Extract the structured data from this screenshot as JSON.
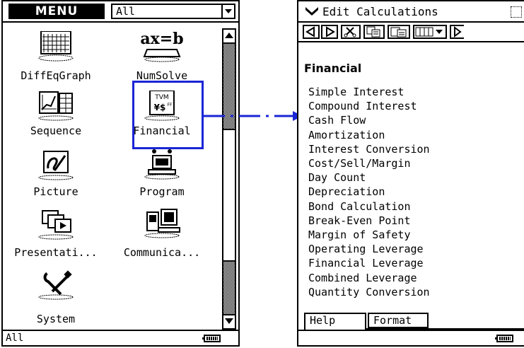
{
  "menu": {
    "title": "MENU",
    "category_value": "All",
    "status_category": "All",
    "apps": [
      {
        "label": "DiffEqGraph",
        "icon": "diffeqgraph-icon"
      },
      {
        "label": "NumSolve",
        "icon": "numsolve-icon",
        "icon_text": "ax=b"
      },
      {
        "label": "Sequence",
        "icon": "sequence-icon"
      },
      {
        "label": "Financial",
        "icon": "financial-icon",
        "icon_text_1": "TVM",
        "icon_text_2": "¥$",
        "icon_text_3": "FF"
      },
      {
        "label": "Picture",
        "icon": "picture-icon"
      },
      {
        "label": "Program",
        "icon": "program-icon"
      },
      {
        "label": "Presentati...",
        "icon": "presentation-icon"
      },
      {
        "label": "Communica...",
        "icon": "communication-icon"
      },
      {
        "label": "System",
        "icon": "system-icon"
      }
    ],
    "scroll_position": 0.62
  },
  "highlight_color": "#1a25d6",
  "financial": {
    "window_title": "Edit Calculations",
    "heading": "Financial",
    "calculations": [
      "Simple Interest",
      "Compound Interest",
      "Cash Flow",
      "Amortization",
      "Interest Conversion",
      "Cost/Sell/Margin",
      "Day Count",
      "Depreciation",
      "Bond Calculation",
      "Break-Even Point",
      "Margin of Safety",
      "Operating Leverage",
      "Financial Leverage",
      "Combined Leverage",
      "Quantity Conversion"
    ],
    "tabs": [
      "Help",
      "Format"
    ]
  }
}
